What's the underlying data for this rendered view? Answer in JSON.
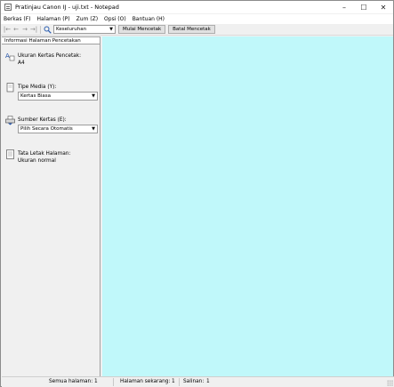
{
  "window": {
    "title": "Pratinjau Canon IJ - uji.txt - Notepad",
    "controls": {
      "minimize": "–",
      "maximize": "☐",
      "close": "✕"
    }
  },
  "menu": {
    "items": [
      "Berkas (F)",
      "Halaman (P)",
      "Zum (Z)",
      "Opsi (O)",
      "Bantuan (H)"
    ]
  },
  "toolbar": {
    "nav_icons": {
      "first": "|←",
      "prev": "←",
      "next": "→",
      "last": "→|",
      "zoom": "🔍"
    },
    "zoom_value": "Keseluruhan",
    "start_print_label": "Mulai Mencetak",
    "cancel_print_label": "Batal Mencetak"
  },
  "panel": {
    "header": "Informasi Halaman Pencetakan",
    "paper_size": {
      "label": "Ukuran Kertas Pencetak:",
      "value": "A4",
      "icon": "paper-size-icon"
    },
    "media_type": {
      "label": "Tipe Media (Y):",
      "value": "Kertas Biasa",
      "icon": "media-type-icon"
    },
    "paper_source": {
      "label": "Sumber Kertas (E):",
      "value": "Pilih Secara Otomatis",
      "icon": "paper-source-icon"
    },
    "page_layout": {
      "label": "Tata Letak Halaman:",
      "value": "Ukuran normal",
      "icon": "page-layout-icon"
    }
  },
  "preview": {
    "background": "#c0f8fa"
  },
  "status": {
    "total_pages_label": "Semua halaman:",
    "total_pages": "1",
    "current_page_label": "Halaman sekarang:",
    "current_page": "1",
    "copies_label": "Salinan:",
    "copies": "1"
  }
}
